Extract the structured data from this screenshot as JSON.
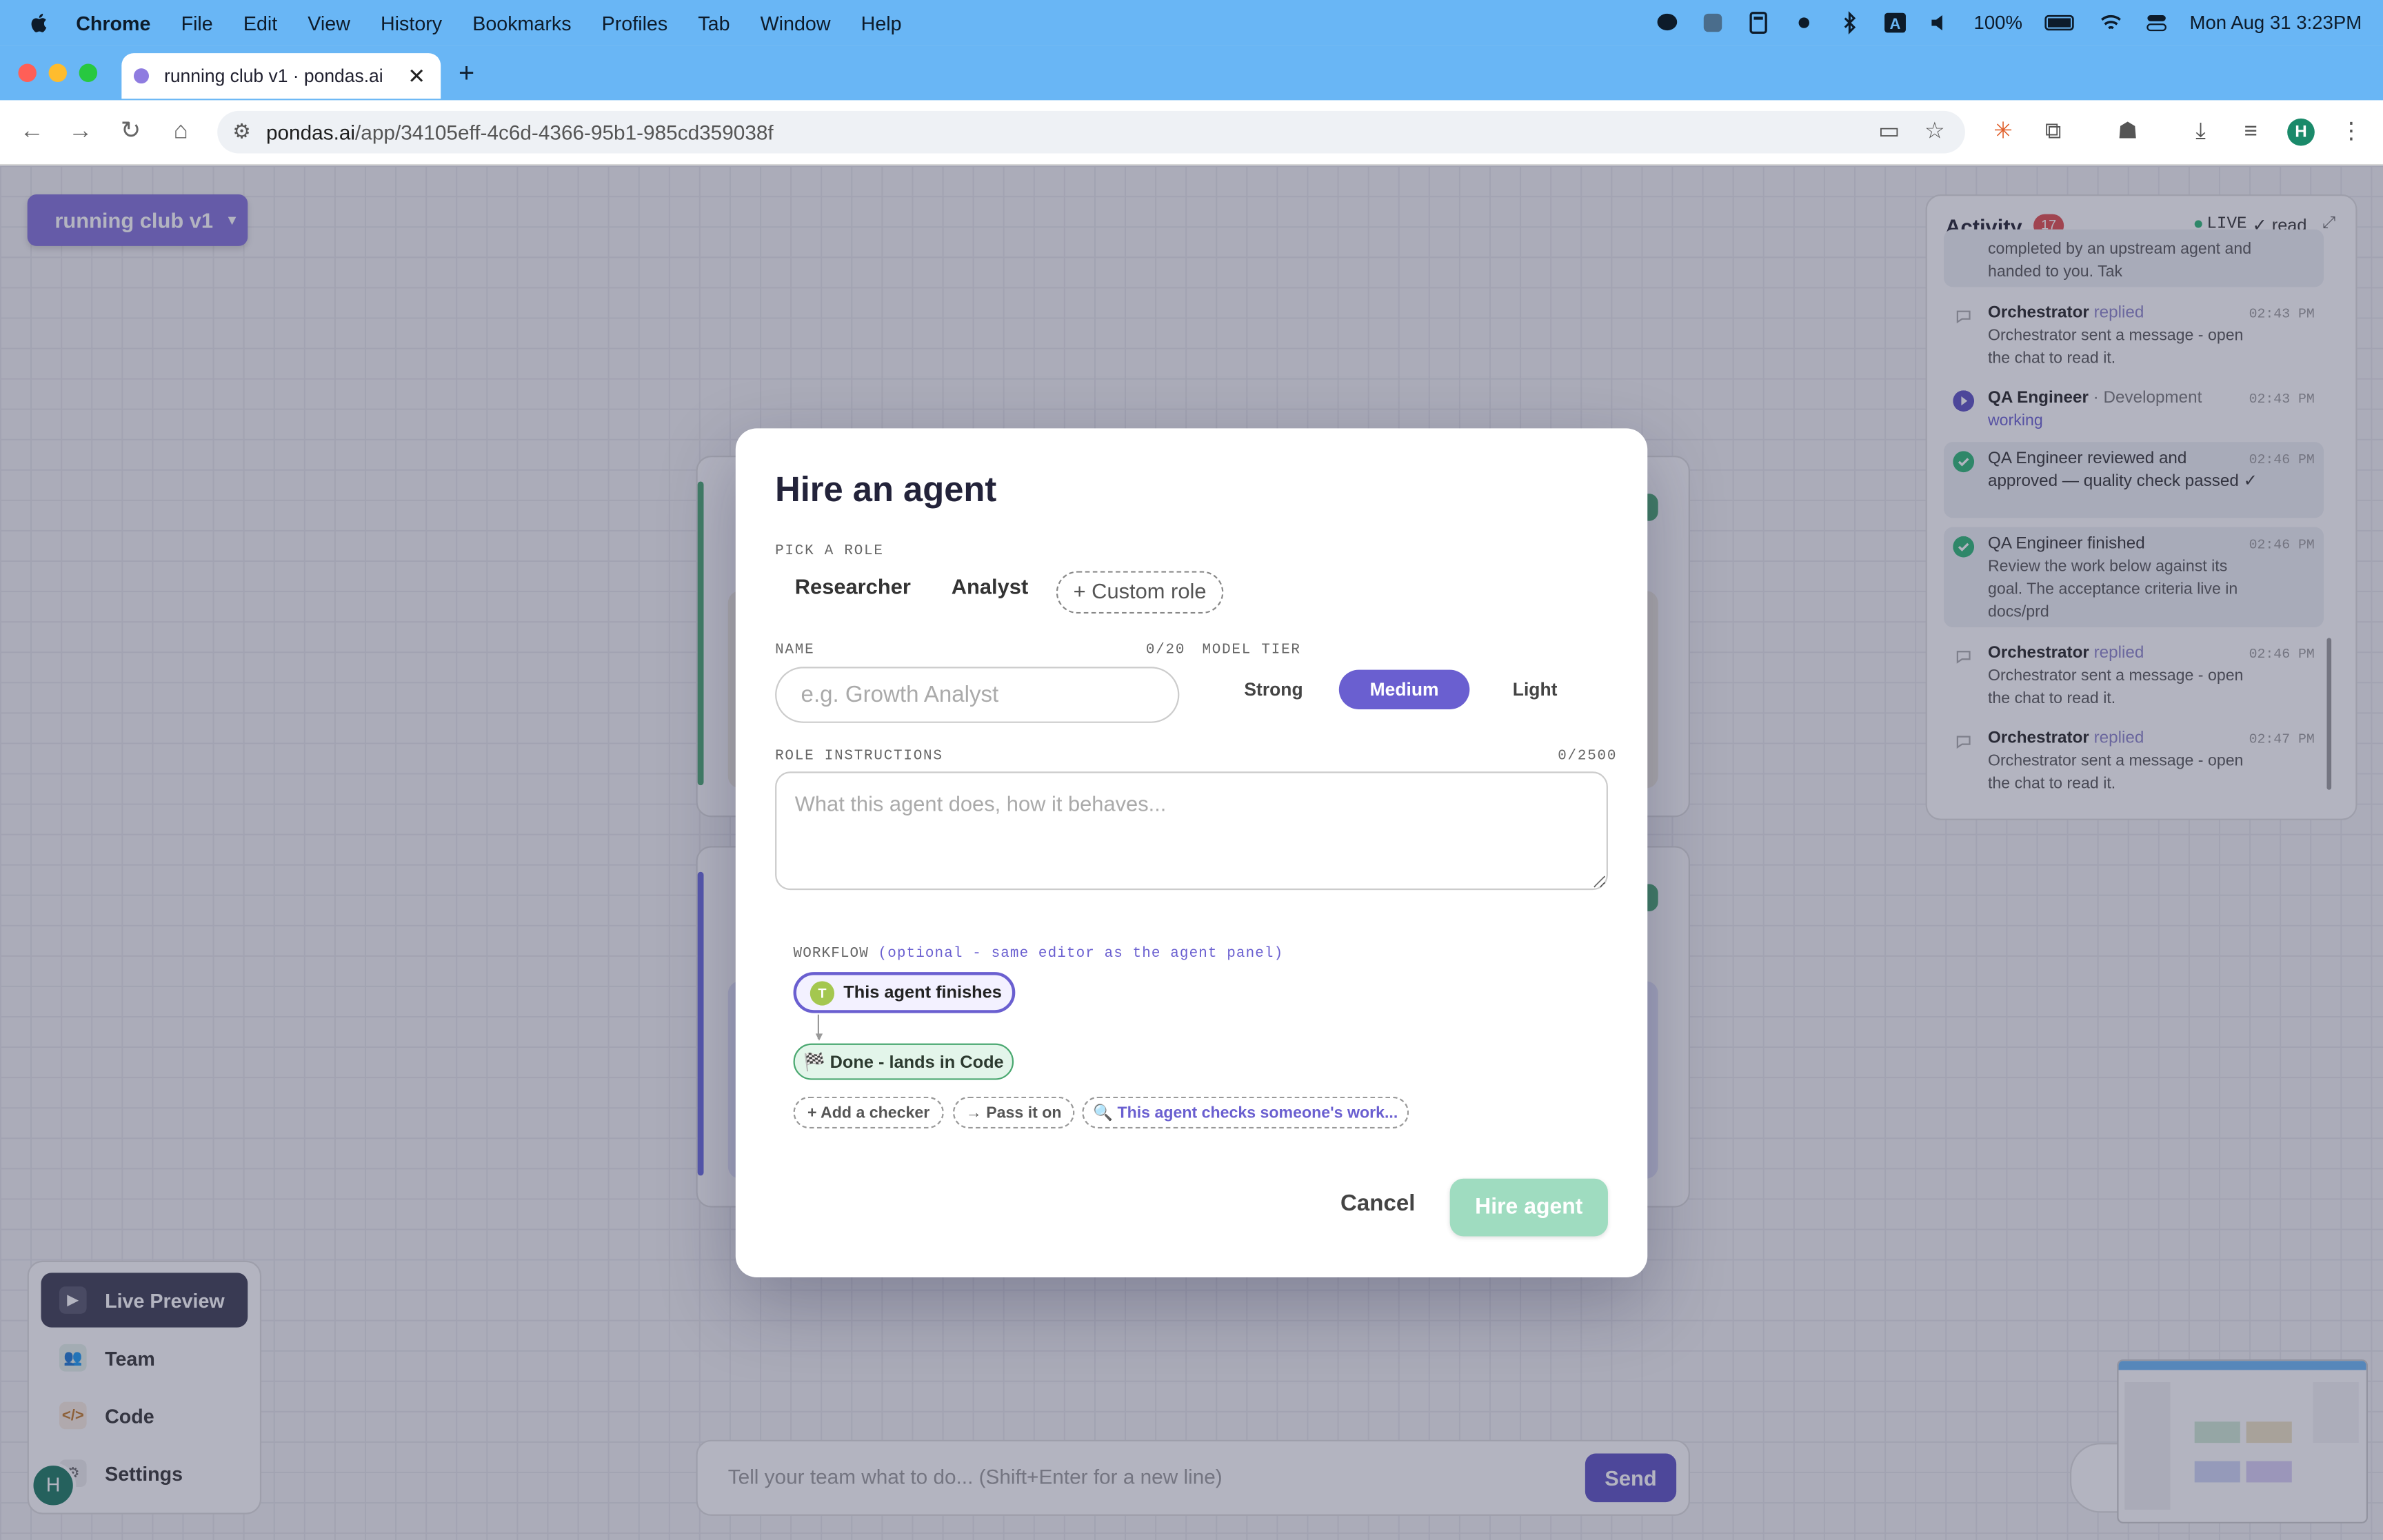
{
  "menubar": {
    "app": "Chrome",
    "items": [
      "File",
      "Edit",
      "View",
      "History",
      "Bookmarks",
      "Profiles",
      "Tab",
      "Window",
      "Help"
    ],
    "battery": "100%",
    "datetime": "Mon Aug 31  3:23PM"
  },
  "browser": {
    "tab_title": "running club v1 · pondas.ai",
    "url_host": "pondas.ai",
    "url_path": "/app/34105eff-4c6d-4366-95b1-985cd359038f",
    "profile_initial": "H"
  },
  "app": {
    "project_name": "running club v1",
    "nav": [
      {
        "label": "Live Preview",
        "icon": "play-icon"
      },
      {
        "label": "Team",
        "icon": "team-icon"
      },
      {
        "label": "Code",
        "icon": "code-icon"
      },
      {
        "label": "Settings",
        "icon": "gear-icon"
      }
    ],
    "user_initial": "H",
    "chat_placeholder": "Tell your team what to do...  (Shift+Enter for a new line)",
    "send_label": "Send"
  },
  "activity": {
    "title": "Activity",
    "count": "17",
    "live": "LIVE",
    "read": "✓ read",
    "items": [
      {
        "who": "Orchestrator",
        "verb": "replied",
        "time": "02:43 PM",
        "msg": "Orchestrator sent a message - open the chat to read it.",
        "icon": "chat-icon"
      },
      {
        "who": "QA Engineer",
        "verb": "· Development",
        "time": "02:43 PM",
        "msg": "working",
        "icon": "play-icon"
      },
      {
        "who": "QA Engineer reviewed and approved — quality check passed ✓",
        "verb": "",
        "time": "02:46 PM",
        "msg": "",
        "icon": "check-icon"
      },
      {
        "who": "QA Engineer finished",
        "verb": "",
        "time": "02:46 PM",
        "msg": "Review the work below against its goal. The acceptance criteria live in docs/prd",
        "icon": "check-icon"
      },
      {
        "who": "Orchestrator",
        "verb": "replied",
        "time": "02:46 PM",
        "msg": "Orchestrator sent a message - open the chat to read it.",
        "icon": "chat-icon"
      },
      {
        "who": "Orchestrator",
        "verb": "replied",
        "time": "02:47 PM",
        "msg": "Orchestrator sent a message - open the chat to read it.",
        "icon": "chat-icon"
      }
    ],
    "truncated_top": "completed by an upstream agent and handed to you. Tak"
  },
  "modal": {
    "title": "Hire an agent",
    "pick_role_label": "PICK A ROLE",
    "roles": [
      "Researcher",
      "Analyst"
    ],
    "custom_role": "+ Custom role",
    "name_label": "NAME",
    "name_count": "0/20",
    "name_placeholder": "e.g. Growth Analyst",
    "model_tier_label": "MODEL TIER",
    "tiers": [
      "Strong",
      "Medium",
      "Light"
    ],
    "selected_tier": "Medium",
    "instructions_label": "ROLE INSTRUCTIONS",
    "instructions_count": "0/2500",
    "instructions_placeholder": "What this agent does, how it behaves...",
    "workflow_label": "WORKFLOW",
    "workflow_note": "(optional - same editor as the agent panel)",
    "workflow_start": "This agent finishes",
    "workflow_start_initial": "T",
    "workflow_done": "🏁 Done - lands in Code",
    "chips": [
      "+ Add a checker",
      "→ Pass it on",
      "🔍 This agent checks someone's work..."
    ],
    "cancel": "Cancel",
    "hire": "Hire agent"
  },
  "colors": {
    "accent": "#6a5fd0",
    "hire_disabled": "#9fdcc0",
    "menubar": "#69b6f5",
    "badge": "#e14b4b"
  }
}
